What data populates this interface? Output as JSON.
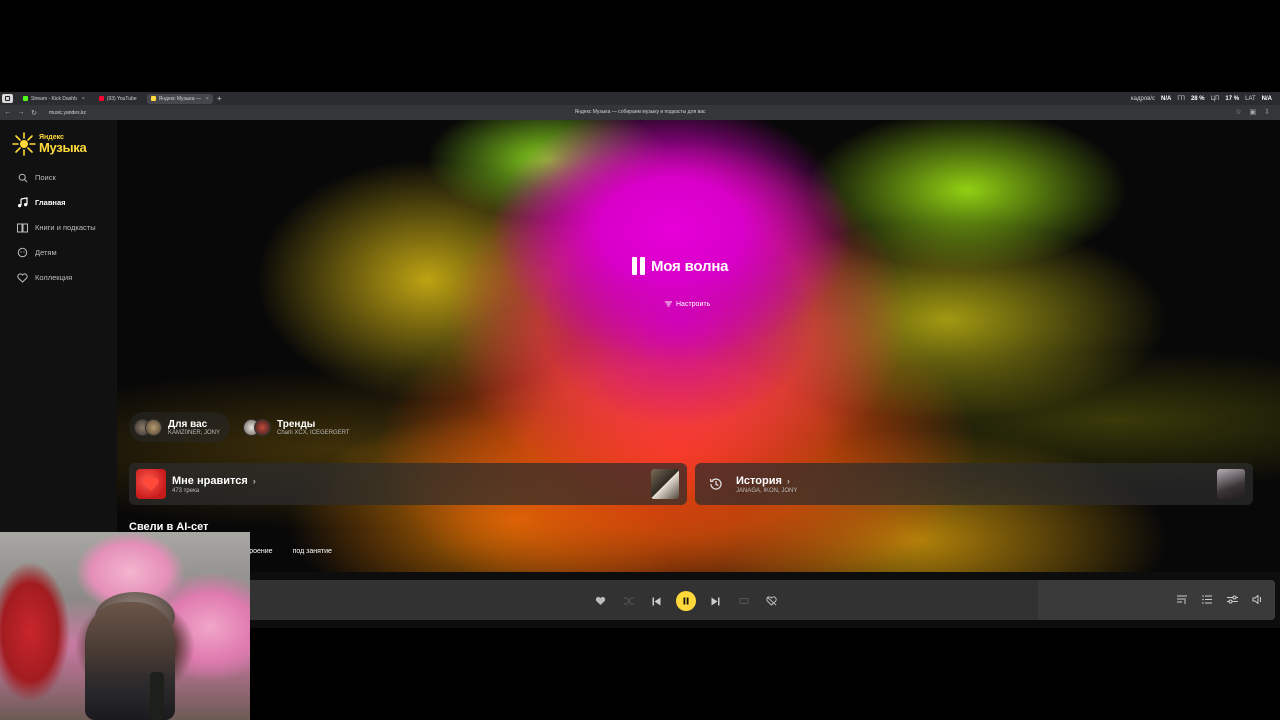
{
  "browser": {
    "tabs": [
      {
        "label": "Stream - Kick Dashb",
        "favicon_color": "#53fc18",
        "active": false
      },
      {
        "label": "(93) YouTube",
        "favicon_color": "#ff0033",
        "active": false
      },
      {
        "label": "Яндекс Музыка —",
        "favicon_color": "#ffdb3d",
        "active": true
      }
    ],
    "new_tab_label": "+",
    "stats": [
      {
        "label": "кадров/с",
        "value": "N/A"
      },
      {
        "label": "ГП",
        "value": "28 %"
      },
      {
        "label": "ЦП",
        "value": "17 %"
      },
      {
        "label": "LAT",
        "value": "N/A"
      }
    ],
    "url": "music.yandex.kz",
    "page_title": "Яндекс Музыка — собираем музыку и подкасты для вас"
  },
  "sidebar": {
    "logo_small": "Яндекс",
    "logo_big": "Музыка",
    "items": [
      {
        "label": "Поиск",
        "icon": "search-icon",
        "active": false
      },
      {
        "label": "Главная",
        "icon": "music-note-icon",
        "active": true
      },
      {
        "label": "Книги и подкасты",
        "icon": "book-icon",
        "active": false
      },
      {
        "label": "Детям",
        "icon": "kids-icon",
        "active": false
      },
      {
        "label": "Коллекция",
        "icon": "heart-icon",
        "active": false
      }
    ]
  },
  "wave": {
    "title": "Моя волна",
    "tune_label": "Настроить"
  },
  "chips": [
    {
      "title": "Для вас",
      "subtitle": "KAMZ0NER, JONY"
    },
    {
      "title": "Тренды",
      "subtitle": "Charli XCX, ICEGERGERT"
    }
  ],
  "cards": {
    "like": {
      "title": "Мне нравится",
      "subtitle": "473 трека"
    },
    "history": {
      "title": "История",
      "subtitle": "JANAGA, IKON, JONY"
    }
  },
  "ai_section": {
    "title": "Свели в AI-сет",
    "tabs": [
      "троение",
      "под занятие"
    ]
  },
  "player": {
    "state": "playing",
    "accent": "#ffd83a"
  }
}
